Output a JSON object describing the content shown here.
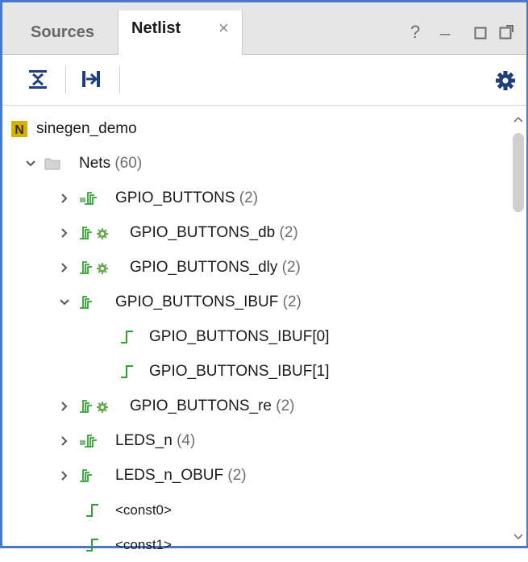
{
  "tabs": {
    "sources": "Sources",
    "netlist": "Netlist",
    "close": "×"
  },
  "window_controls": {
    "help": "?",
    "minimize": "_",
    "restore": "□",
    "float": "⧉"
  },
  "toolbar": {
    "collapse_all_icon": "collapse-all-icon",
    "expand_icon": "expand-selected-icon",
    "settings_icon": "gear-icon"
  },
  "tree": {
    "root": {
      "label": "sinegen_demo"
    },
    "nets": {
      "label": "Nets",
      "count": "(60)"
    },
    "items": [
      {
        "label": "GPIO_BUTTONS",
        "count": "(2)"
      },
      {
        "label": "GPIO_BUTTONS_db",
        "count": "(2)"
      },
      {
        "label": "GPIO_BUTTONS_dly",
        "count": "(2)"
      },
      {
        "label": "GPIO_BUTTONS_IBUF",
        "count": "(2)"
      },
      {
        "label": "GPIO_BUTTONS_IBUF[0]",
        "count": ""
      },
      {
        "label": "GPIO_BUTTONS_IBUF[1]",
        "count": ""
      },
      {
        "label": "GPIO_BUTTONS_re",
        "count": "(2)"
      },
      {
        "label": "LEDS_n",
        "count": "(4)"
      },
      {
        "label": "LEDS_n_OBUF",
        "count": "(2)"
      },
      {
        "label": "<const0>",
        "count": ""
      },
      {
        "label": "<const1>",
        "count": ""
      }
    ]
  },
  "colors": {
    "accent_border": "#4a78c9",
    "net_green": "#2fa52f",
    "root_badge": "#d8b000"
  }
}
